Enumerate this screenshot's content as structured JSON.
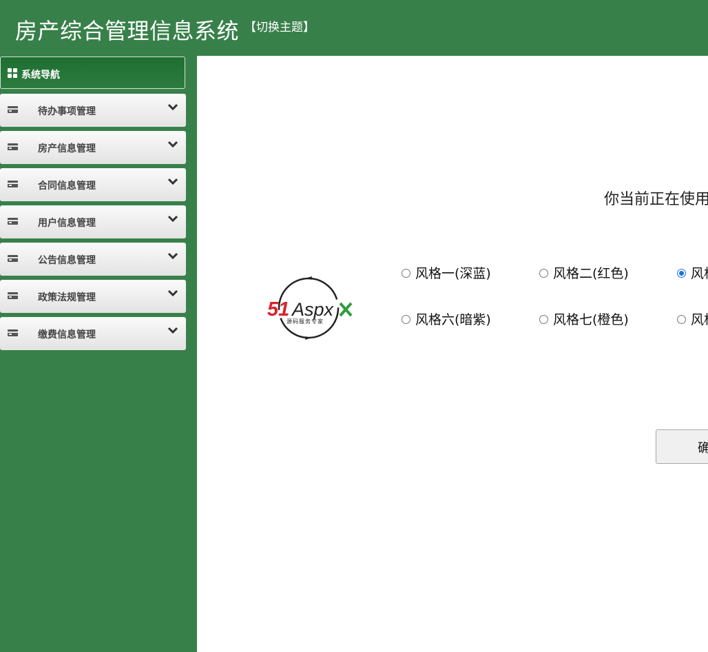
{
  "header": {
    "title": "房产综合管理信息系统",
    "theme_switch": "【切换主题】"
  },
  "sidebar": {
    "nav_title": "系统导航",
    "items": [
      {
        "label": "待办事项管理",
        "icon": "card-icon"
      },
      {
        "label": "房产信息管理",
        "icon": "card-icon"
      },
      {
        "label": "合同信息管理",
        "icon": "card-icon"
      },
      {
        "label": "用户信息管理",
        "icon": "card-icon"
      },
      {
        "label": "公告信息管理",
        "icon": "card-icon"
      },
      {
        "label": "政策法规管理",
        "icon": "card-icon"
      },
      {
        "label": "缴费信息管理",
        "icon": "card-icon"
      }
    ]
  },
  "main": {
    "current_theme_text": "你当前正在使用",
    "logo": {
      "brand_red": "51",
      "brand_dark": "Aspx",
      "tagline": "源码服务专家"
    },
    "theme_options_row1": [
      {
        "label": "风格一(深蓝)",
        "checked": false
      },
      {
        "label": "风格二(红色)",
        "checked": false
      },
      {
        "label": "风格",
        "checked": true
      }
    ],
    "theme_options_row2": [
      {
        "label": "风格六(暗紫)",
        "checked": false
      },
      {
        "label": "风格七(橙色)",
        "checked": false
      },
      {
        "label": "风格",
        "checked": false
      }
    ],
    "confirm_label": "确定"
  },
  "colors": {
    "primary_green": "#38804a",
    "radio_accent": "#1a73e8",
    "logo_red": "#d9232d",
    "logo_green": "#2e9b3e"
  }
}
